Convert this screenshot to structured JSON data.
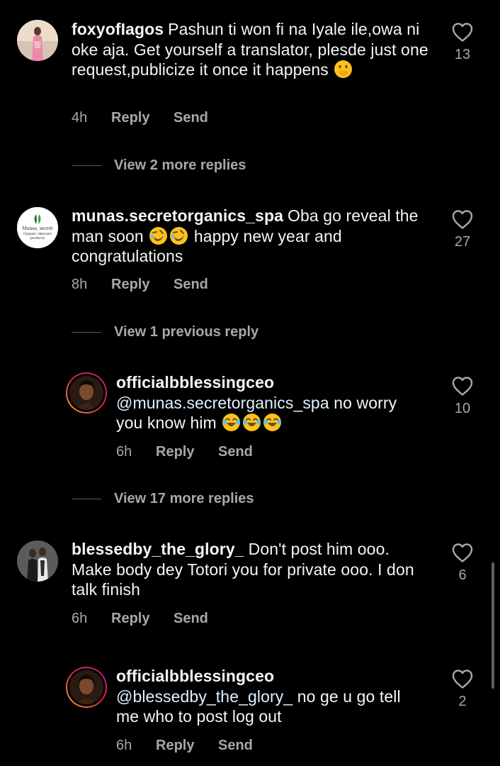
{
  "comments": [
    {
      "username": "foxyofIagos",
      "text": "Pashun ti won fi na Iyale ile,owa ni oke aja. Get yourself a translator, plesde just one request,publicize it once it happens",
      "emoji": "🫢",
      "time": "4h",
      "reply_label": "Reply",
      "send_label": "Send",
      "likes": "13",
      "view_more": "View 2 more replies"
    },
    {
      "username": "munas.secretorganics_spa",
      "text_before": "Oba go reveal the man soon",
      "emoji": "🤣🤣",
      "text_after": "happy new year and congratulations",
      "time": "8h",
      "reply_label": "Reply",
      "send_label": "Send",
      "likes": "27",
      "view_more": "View 1 previous reply",
      "avatar_text_1": "Munas, secret",
      "avatar_text_2": "Organic skincare",
      "avatar_text_3": "products"
    },
    {
      "username": "officialbblessingceo",
      "mention": "@munas.secretorganics_spa",
      "text": "no worry you know him",
      "emoji": "😂😂😂",
      "time": "6h",
      "reply_label": "Reply",
      "send_label": "Send",
      "likes": "10",
      "view_more": "View 17 more replies"
    },
    {
      "username": "blessedby_the_glory_",
      "text": "Don't post him ooo. Make body dey Totori you for private ooo. I don talk finish",
      "time": "6h",
      "reply_label": "Reply",
      "send_label": "Send",
      "likes": "6"
    },
    {
      "username": "officialbblessingceo",
      "mention": "@blessedby_the_glory_",
      "text": "no ge u go tell me who to post log out",
      "time": "6h",
      "reply_label": "Reply",
      "send_label": "Send",
      "likes": "2"
    }
  ],
  "icons": {
    "like": "heart-outline-icon"
  },
  "colors": {
    "background": "#000000",
    "text": "#f5f5f5",
    "muted": "#a8a8a8",
    "mention": "#e0f1ff"
  }
}
